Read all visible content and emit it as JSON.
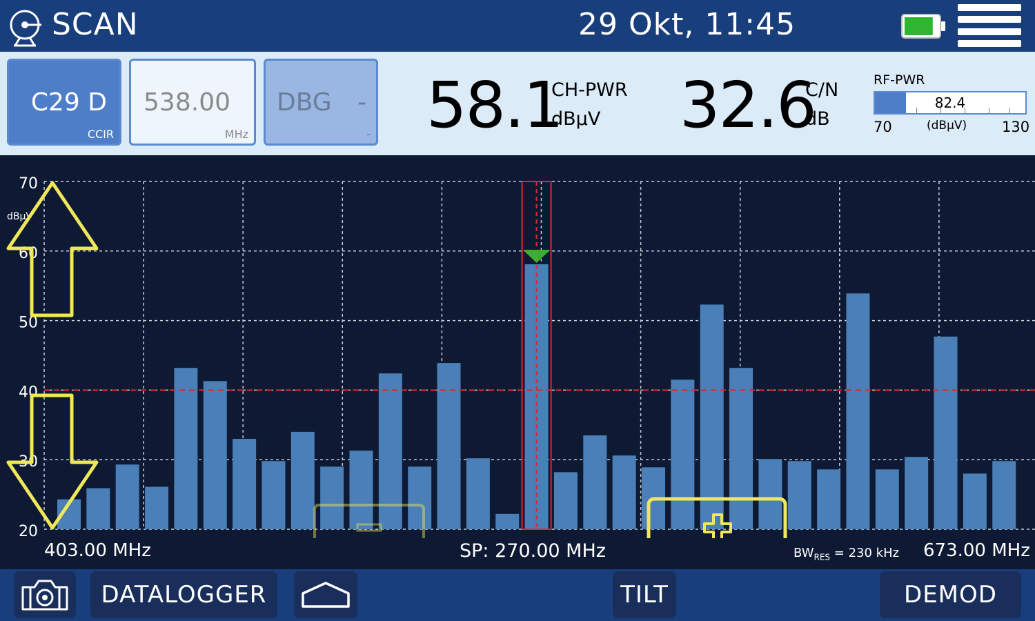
{
  "header": {
    "icon": "antenna-dish-icon",
    "title": "SCAN",
    "datetime": "29 Okt,  11:45",
    "battery_icon": "battery-icon",
    "battery_level": 0.85,
    "battery_color": "#2fb52f",
    "menu_icon": "hamburger-menu-icon"
  },
  "info": {
    "channel": {
      "value": "C29 D",
      "sub": "CCIR"
    },
    "frequency": {
      "value": "538.00",
      "unit": "MHz"
    },
    "dbg": {
      "value": "DBG",
      "dash": "-",
      "sub": "-"
    },
    "ch_pwr": {
      "value": "58.1",
      "label": "CH-PWR",
      "unit": "dBµV"
    },
    "cn": {
      "value": "32.6",
      "label": "C/N",
      "unit": "dB"
    },
    "rf_pwr": {
      "title": "RF-PWR",
      "reading": "82.4",
      "min": "70",
      "max": "130",
      "unit": "(dBµV)",
      "value": 82.4,
      "range": [
        70,
        130
      ]
    }
  },
  "chart_data": {
    "type": "bar",
    "ylabel": "dBµV",
    "ylim": [
      20,
      70
    ],
    "yticks": [
      "70",
      "60",
      "50",
      "40",
      "30",
      "20"
    ],
    "reference_line": 40,
    "selected_index": 16,
    "values": [
      24.3,
      25.9,
      29.3,
      26.1,
      43.2,
      41.3,
      33.0,
      29.8,
      34.0,
      29.0,
      31.3,
      42.4,
      29.0,
      43.9,
      30.2,
      22.2,
      58.1,
      28.2,
      33.5,
      30.6,
      28.9,
      41.5,
      52.3,
      43.2,
      30.1,
      29.8,
      28.6,
      53.9,
      28.6,
      30.4,
      47.7,
      28.0,
      29.8
    ],
    "bar_color": "#4a7fb8",
    "marker_color": "#3fae2f",
    "grid": true
  },
  "xaxis": {
    "start": "403.00 MHz",
    "span": "SP: 270.00 MHz",
    "bw_label": "BW",
    "bw_sub": "RES",
    "bw_value": " = 230 kHz",
    "end": "673.00 MHz"
  },
  "overlays": {
    "up_arrow_icon": "up-arrow-icon",
    "down_arrow_icon": "down-arrow-icon",
    "zoom_out_icon": "minus-icon",
    "zoom_in_icon": "plus-icon",
    "overlay_color": "#f0e85a"
  },
  "footer": {
    "camera_icon": "camera-icon",
    "datalogger": "DATALOGGER",
    "home_icon": "home-icon",
    "tilt": "TILT",
    "demod": "DEMOD"
  }
}
